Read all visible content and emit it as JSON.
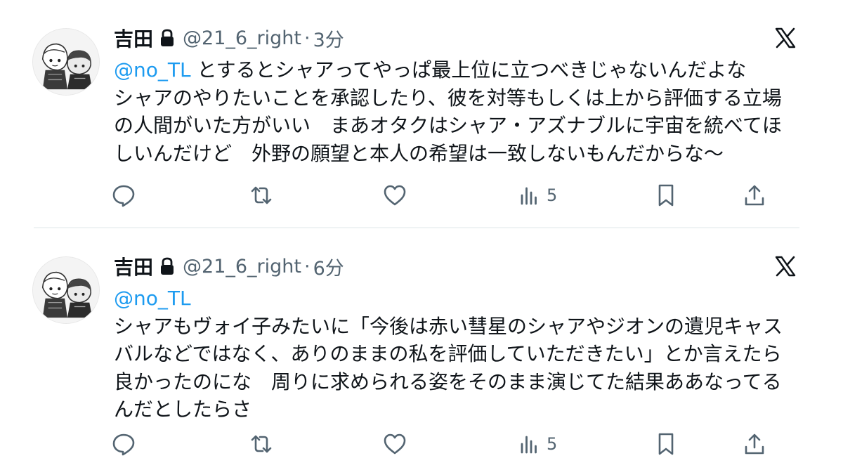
{
  "colors": {
    "text": "#0f1419",
    "secondary": "#536471",
    "mention": "#1d9bf0",
    "divider": "#eff3f4"
  },
  "tweets": [
    {
      "author": {
        "name": "吉田",
        "handle": "@21_6_right",
        "protected_icon": "lock-icon"
      },
      "separator": "·",
      "time": "3分",
      "mention": "@no_TL",
      "text_lines": [
        "とするとシャアってやっぱ最上位に立つべきじゃないんだよな",
        "シャアのやりたいことを承認したり、彼を対等もしくは上から評価する立場",
        "の人間がいた方がいい　まあオタクはシャア・アズナブルに宇宙を統べてほ",
        "しいんだけど　外野の願望と本人の希望は一致しないもんだからな〜"
      ],
      "views": "5"
    },
    {
      "author": {
        "name": "吉田",
        "handle": "@21_6_right",
        "protected_icon": "lock-icon"
      },
      "separator": "·",
      "time": "6分",
      "mention": "@no_TL",
      "text_lines": [
        "シャアもヴォイ子みたいに「今後は赤い彗星のシャアやジオンの遺児キャス",
        "バルなどではなく、ありのままの私を評価していただきたい」とか言えたら",
        "良かったのにな　周りに求められる姿をそのまま演じてた結果ああなってる",
        "んだとしたらさ"
      ],
      "views": "5"
    }
  ]
}
